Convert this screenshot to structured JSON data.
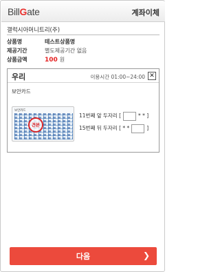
{
  "header": {
    "logo_part1": "Bill",
    "logo_part2": "G",
    "logo_part3": "ate",
    "title": "계좌이체"
  },
  "merchant": {
    "name": "갤럭시아머니트리(주)",
    "rows": [
      {
        "label": "상품명",
        "value": "테스트상품명"
      },
      {
        "label": "제공기간",
        "value": "별도제공기간 없음"
      },
      {
        "label": "상품금액",
        "amount": "100",
        "unit": "원"
      }
    ]
  },
  "bank": {
    "name": "우리",
    "hours": "이용시간 01:00~24:00",
    "close_glyph": "✕",
    "security_card_label": "보안카드",
    "card_title": "보안카드",
    "stamp_text": "견본",
    "code1": {
      "prefix": "11번째 앞 두자리 [",
      "suffix": "* * ]"
    },
    "code2": {
      "prefix": "15번째 뒤 두자리 [ * *",
      "suffix": "]"
    }
  },
  "footer": {
    "next_label": "다음",
    "next_arrow_icon": "chevron-right-icon",
    "next_arrow_glyph": "❯"
  },
  "colors": {
    "accent": "#e8302d",
    "button_bg": "#ec4a3c",
    "price": "#e52020"
  }
}
